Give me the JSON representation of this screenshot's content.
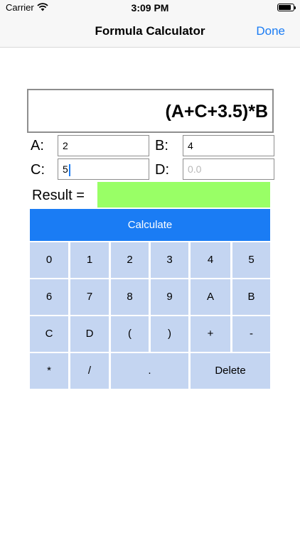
{
  "status_bar": {
    "carrier": "Carrier",
    "time": "3:09 PM"
  },
  "nav": {
    "title": "Formula Calculator",
    "done_label": "Done"
  },
  "formula": "(A+C+3.5)*B",
  "variables": {
    "a": {
      "label": "A:",
      "value": "2"
    },
    "b": {
      "label": "B:",
      "value": "4"
    },
    "c": {
      "label": "C:",
      "value": "5"
    },
    "d": {
      "label": "D:",
      "value": "",
      "placeholder": "0.0"
    }
  },
  "result": {
    "label": "Result =",
    "value": ""
  },
  "calculate_label": "Calculate",
  "keypad": {
    "row1": [
      "0",
      "1",
      "2",
      "3",
      "4",
      "5"
    ],
    "row2": [
      "6",
      "7",
      "8",
      "9",
      "A",
      "B"
    ],
    "row3": [
      "C",
      "D",
      "(",
      ")",
      "+",
      "-"
    ],
    "row4": [
      "*",
      "/",
      ".",
      "Delete"
    ]
  },
  "colors": {
    "accent": "#1a7cf4",
    "key_bg": "#c4d5f1",
    "result_bg": "#99ff66"
  }
}
